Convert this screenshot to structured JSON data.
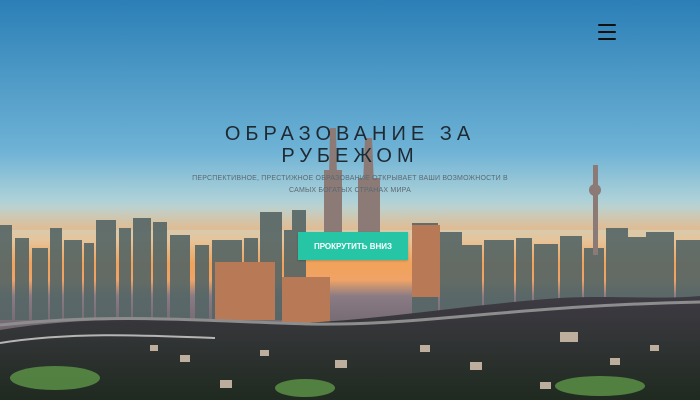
{
  "hero": {
    "title_line_1": "ОБРАЗОВАНИЕ ЗА",
    "title_line_2": "РУБЕЖОМ",
    "subtitle": "ПЕРСПЕКТИВНОЕ, ПРЕСТИЖНОЕ ОБРАЗОВАНИЕ ОТКРЫВАЕТ ВАШИ ВОЗМОЖНОСТИ В САМЫХ БОГАТЫХ СТРАНАХ МИРА",
    "scroll_button": "ПРОКРУТИТЬ ВНИЗ"
  },
  "colors": {
    "accent": "#25c5a6",
    "title": "#1f2a33"
  },
  "icons": {
    "menu": "hamburger-menu-icon"
  }
}
